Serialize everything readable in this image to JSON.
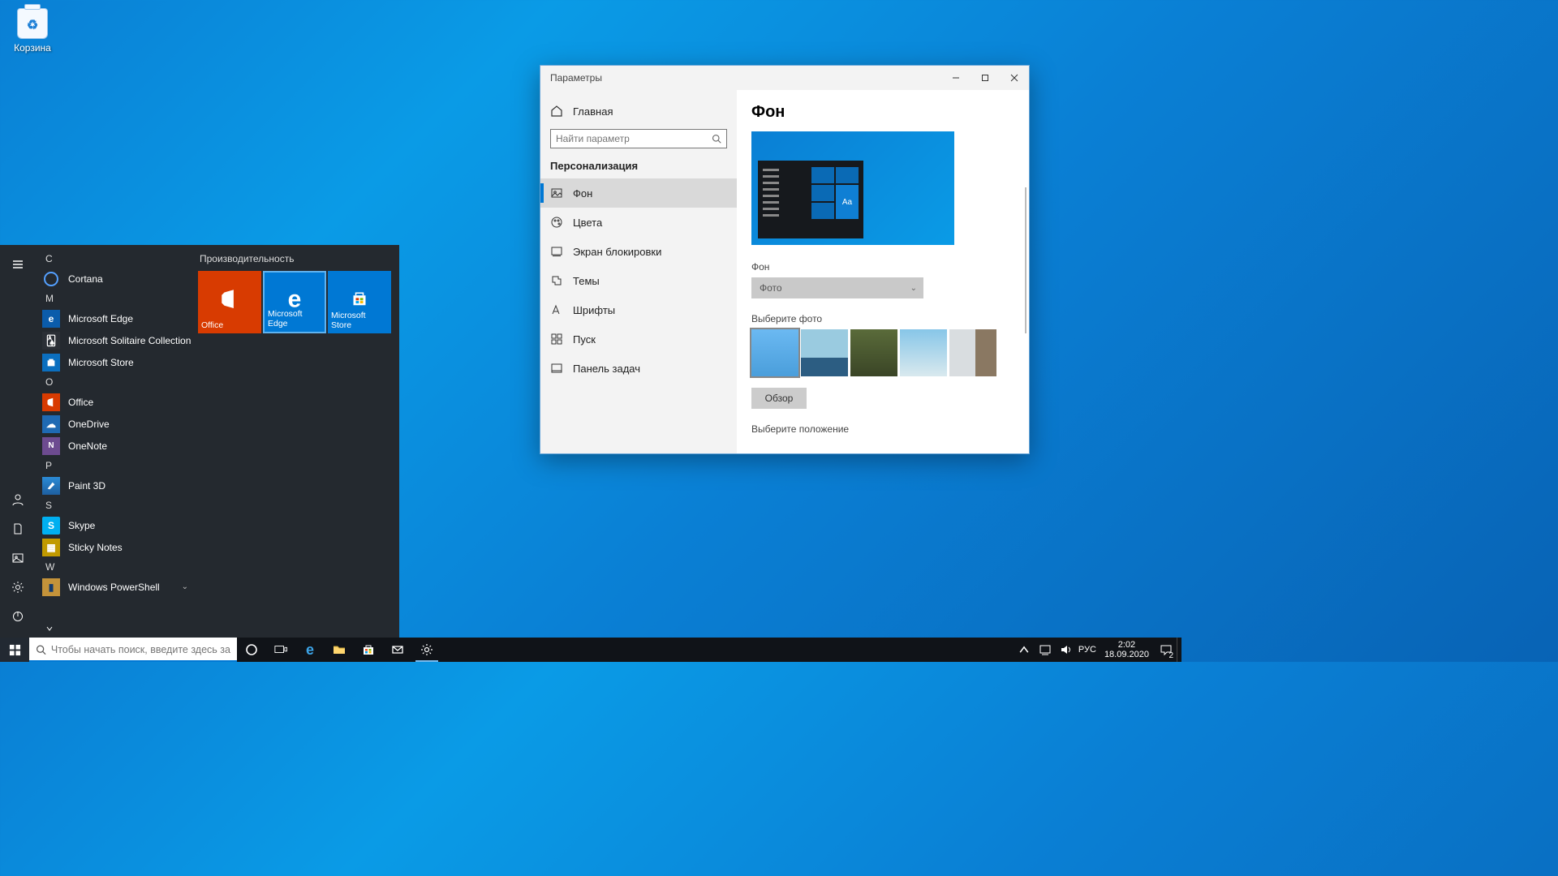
{
  "desktop": {
    "recycle_bin_label": "Корзина"
  },
  "taskbar": {
    "search_placeholder": "Чтобы начать поиск, введите здесь запрос",
    "time": "2:02",
    "date": "18.09.2020",
    "lang": "РУС",
    "notification_count": "2"
  },
  "start_menu": {
    "tiles_header": "Производительность",
    "tiles": {
      "office": "Office",
      "edge": "Microsoft Edge",
      "store": "Microsoft Store"
    },
    "groups": {
      "c": "C",
      "m": "M",
      "o": "O",
      "p": "P",
      "s": "S",
      "w": "W"
    },
    "apps": {
      "cortana": "Cortana",
      "edge": "Microsoft Edge",
      "solitaire": "Microsoft Solitaire Collection",
      "store": "Microsoft Store",
      "office": "Office",
      "onedrive": "OneDrive",
      "onenote": "OneNote",
      "paint3d": "Paint 3D",
      "skype": "Skype",
      "sticky": "Sticky Notes",
      "powershell": "Windows PowerShell"
    }
  },
  "settings": {
    "window_title": "Параметры",
    "side": {
      "home": "Главная",
      "search_placeholder": "Найти параметр",
      "section": "Персонализация",
      "items": {
        "background": "Фон",
        "colors": "Цвета",
        "lockscreen": "Экран блокировки",
        "themes": "Темы",
        "fonts": "Шрифты",
        "start": "Пуск",
        "taskbar": "Панель задач"
      }
    },
    "main": {
      "title": "Фон",
      "preview_aa": "Aa",
      "bg_label": "Фон",
      "bg_dropdown": "Фото",
      "choose_photo": "Выберите фото",
      "browse": "Обзор",
      "choose_fit": "Выберите положение"
    }
  }
}
